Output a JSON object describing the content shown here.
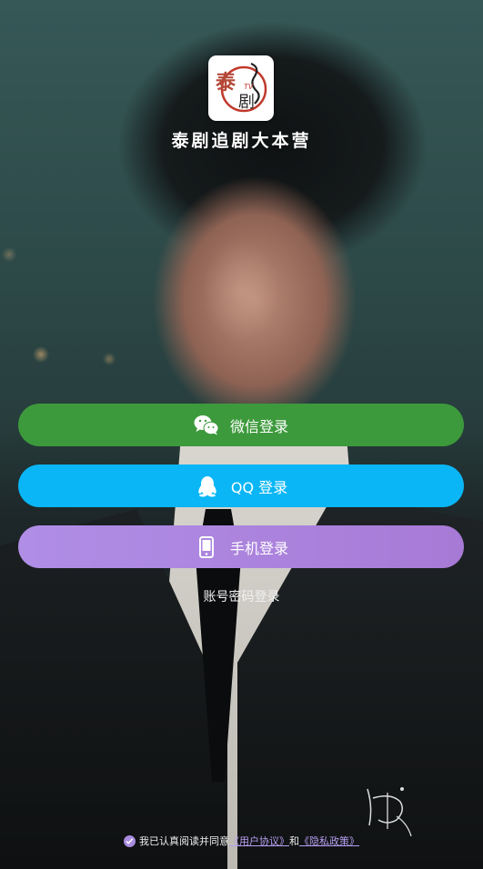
{
  "app": {
    "title": "泰剧追剧大本营",
    "logo_text_main": "泰",
    "logo_text_sub": "剧",
    "logo_text_tv": "TV"
  },
  "login": {
    "wechat_label": "微信登录",
    "qq_label": "QQ 登录",
    "phone_label": "手机登录",
    "account_password_label": "账号密码登录"
  },
  "agreement": {
    "prefix": "我已认真阅读并同意",
    "user_agreement": "《用户协议》",
    "and": "和",
    "privacy_policy": "《隐私政策》",
    "checked": true
  },
  "colors": {
    "wechat": "#3d9a3c",
    "qq": "#0ab6f5",
    "phone_start": "#b08ee6",
    "phone_end": "#a77ad6",
    "logo_red": "#c0392b",
    "agreement_accent": "#a98be0"
  },
  "icons": {
    "wechat": "wechat-icon",
    "qq": "qq-penguin-icon",
    "phone": "smartphone-icon",
    "check": "check-icon"
  }
}
